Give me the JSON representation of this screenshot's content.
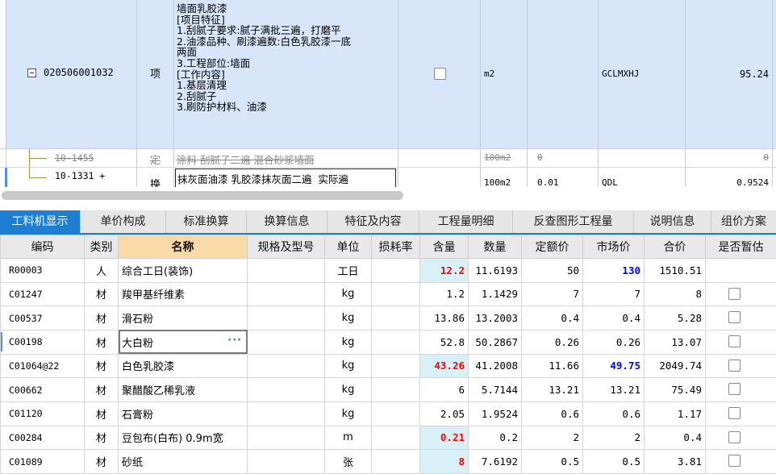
{
  "top_rows": {
    "row1": {
      "code": "020506001032",
      "type": "项",
      "description": "墙面乳胶漆\n[项目特征]\n1.刮腻子要求:腻子满批三遍，打磨平\n2.油漆品种、刷漆遍数:白色乳胶漆一底\n两面\n3.工程部位:墙面\n[工作内容]\n1.基层清理\n2.刮腻子\n3.刷防护材料、油漆",
      "unit": "m2",
      "code2": "GCLMXHJ",
      "value": "95.24"
    },
    "row2": {
      "code": "10-1455",
      "type": "定",
      "description": "涂料 刮腻子二遍 混合砂浆墙面",
      "unit": "100m2",
      "qty": "0",
      "value": "0"
    },
    "row3": {
      "code": "10-1331 +",
      "type": "换",
      "description": "抹灰面油漆 乳胶漆抹灰面二遍  实际遍",
      "unit": "100m2",
      "qty": "0.01",
      "code2": "QDL",
      "value": "0.9524"
    }
  },
  "tabs": [
    "工料机显示",
    "单价构成",
    "标准换算",
    "换算信息",
    "特征及内容",
    "工程量明细",
    "反查图形工程量",
    "说明信息",
    "组价方案"
  ],
  "table": {
    "headers": [
      "编码",
      "类别",
      "名称",
      "规格及型号",
      "单位",
      "损耗率",
      "含量",
      "数量",
      "定额价",
      "市场价",
      "合价",
      "是否暂估"
    ],
    "rows": [
      {
        "code": "R00003",
        "cat": "人",
        "name": "综合工日(装饰)",
        "spec": "",
        "unit": "工日",
        "loss": "",
        "content": "12.2",
        "qty": "11.6193",
        "base": "50",
        "market": "130",
        "total": "1510.51"
      },
      {
        "code": "C01247",
        "cat": "材",
        "name": "羧甲基纤维素",
        "spec": "",
        "unit": "kg",
        "loss": "",
        "content": "1.2",
        "qty": "1.1429",
        "base": "7",
        "market": "7",
        "total": "8"
      },
      {
        "code": "C00537",
        "cat": "材",
        "name": "滑石粉",
        "spec": "",
        "unit": "kg",
        "loss": "",
        "content": "13.86",
        "qty": "13.2003",
        "base": "0.4",
        "market": "0.4",
        "total": "5.28"
      },
      {
        "code": "C00198",
        "cat": "材",
        "name": "大白粉",
        "spec": "",
        "unit": "kg",
        "loss": "",
        "content": "52.8",
        "qty": "50.2867",
        "base": "0.26",
        "market": "0.26",
        "total": "13.07"
      },
      {
        "code": "C01064@22",
        "cat": "材",
        "name": "白色乳胶漆",
        "spec": "",
        "unit": "kg",
        "loss": "",
        "content": "43.26",
        "qty": "41.2008",
        "base": "11.66",
        "market": "49.75",
        "total": "2049.74"
      },
      {
        "code": "C00662",
        "cat": "材",
        "name": "聚醋酸乙稀乳液",
        "spec": "",
        "unit": "kg",
        "loss": "",
        "content": "6",
        "qty": "5.7144",
        "base": "13.21",
        "market": "13.21",
        "total": "75.49"
      },
      {
        "code": "C01120",
        "cat": "材",
        "name": "石膏粉",
        "spec": "",
        "unit": "kg",
        "loss": "",
        "content": "2.05",
        "qty": "1.9524",
        "base": "0.6",
        "market": "0.6",
        "total": "1.17"
      },
      {
        "code": "C00284",
        "cat": "材",
        "name": "豆包布(白布) 0.9m宽",
        "spec": "",
        "unit": "m",
        "loss": "",
        "content": "0.21",
        "qty": "0.2",
        "base": "2",
        "market": "2",
        "total": "0.4"
      },
      {
        "code": "C01089",
        "cat": "材",
        "name": "砂纸",
        "spec": "",
        "unit": "张",
        "loss": "",
        "content": "8",
        "qty": "7.6192",
        "base": "0.5",
        "market": "0.5",
        "total": "3.81"
      }
    ]
  },
  "colors": {
    "accent": "#1e7fd2",
    "selected_row": "#d7e6fb",
    "content_cell": "#d8f1f8",
    "highlight_header": "#f9d9a6"
  }
}
